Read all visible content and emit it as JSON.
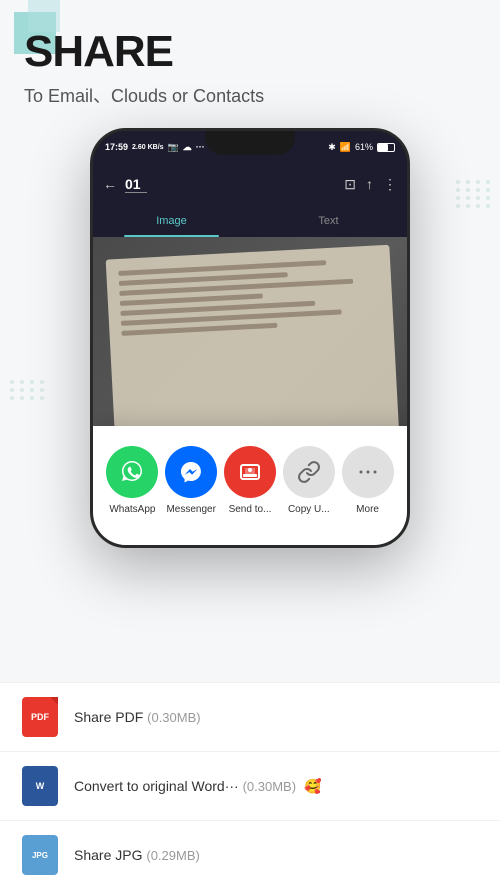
{
  "header": {
    "title": "SHARE",
    "subtitle": "To Email、Clouds or Contacts"
  },
  "phone": {
    "status_bar": {
      "time": "17:59",
      "data": "2.60 KB/s",
      "battery": "61%"
    },
    "app_bar": {
      "back_icon": "←",
      "page_number": "01",
      "crop_icon": "⊞",
      "share_icon": "⬆",
      "more_icon": "⋮"
    },
    "tabs": [
      {
        "label": "Image",
        "active": true
      },
      {
        "label": "Text",
        "active": false
      }
    ]
  },
  "share_sheet": {
    "items": [
      {
        "id": "whatsapp",
        "label": "WhatsApp",
        "color": "whatsapp",
        "icon": "✆"
      },
      {
        "id": "messenger",
        "label": "Messenger",
        "color": "messenger",
        "icon": "💬"
      },
      {
        "id": "sendto",
        "label": "Send to...",
        "color": "sendto",
        "icon": "🖥"
      },
      {
        "id": "copy",
        "label": "Copy U...",
        "color": "copy",
        "icon": "🔗"
      },
      {
        "id": "more",
        "label": "More",
        "color": "more",
        "icon": "···"
      }
    ]
  },
  "bottom_list": {
    "items": [
      {
        "id": "share-pdf",
        "icon_type": "pdf",
        "icon_label": "PDF",
        "text": "Share PDF",
        "size": "(0.30MB)"
      },
      {
        "id": "convert-word",
        "icon_type": "word",
        "icon_label": "W",
        "text": "Convert to original Word···",
        "size": "(0.30MB)",
        "emoji": "🥰"
      },
      {
        "id": "share-jpg",
        "icon_type": "jpg",
        "icon_label": "JPG",
        "text": "Share JPG",
        "size": "(0.29MB)"
      }
    ]
  }
}
